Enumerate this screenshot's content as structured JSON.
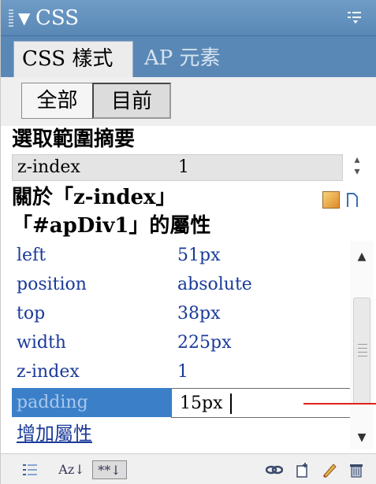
{
  "panel": {
    "title": "CSS",
    "title_arrow": "▼"
  },
  "tabs": [
    {
      "label": "CSS 樣式"
    },
    {
      "label": "AP 元素"
    }
  ],
  "modes": {
    "all_label": "全部",
    "current_label": "目前"
  },
  "summary": {
    "heading": "選取範圍摘要",
    "row": {
      "key": "z-index",
      "value": "1"
    }
  },
  "about": {
    "heading": "關於「z-index」"
  },
  "properties": {
    "heading": "「#apDiv1」的屬性",
    "rows": [
      {
        "key": "left",
        "value": "51px"
      },
      {
        "key": "position",
        "value": "absolute"
      },
      {
        "key": "top",
        "value": "38px"
      },
      {
        "key": "width",
        "value": "225px"
      },
      {
        "key": "z-index",
        "value": "1"
      }
    ],
    "editing": {
      "key": "padding",
      "value": "15px"
    },
    "add_label": "增加屬性"
  },
  "toolbar": {
    "sort_az_label": "Az↓",
    "set_props_label": "**↓"
  },
  "icons": {
    "options": "options-menu-icon",
    "category_view": "category-view-icon",
    "attach_stylesheet": "attach-stylesheet-icon",
    "new_rule": "new-css-rule-icon",
    "edit": "edit-style-icon",
    "delete": "trash-icon"
  },
  "colors": {
    "title_bar": "#6f9cc6",
    "selected_row": "#3b7fc9",
    "link": "#1a3a9a",
    "annotation_line": "#e02020"
  }
}
